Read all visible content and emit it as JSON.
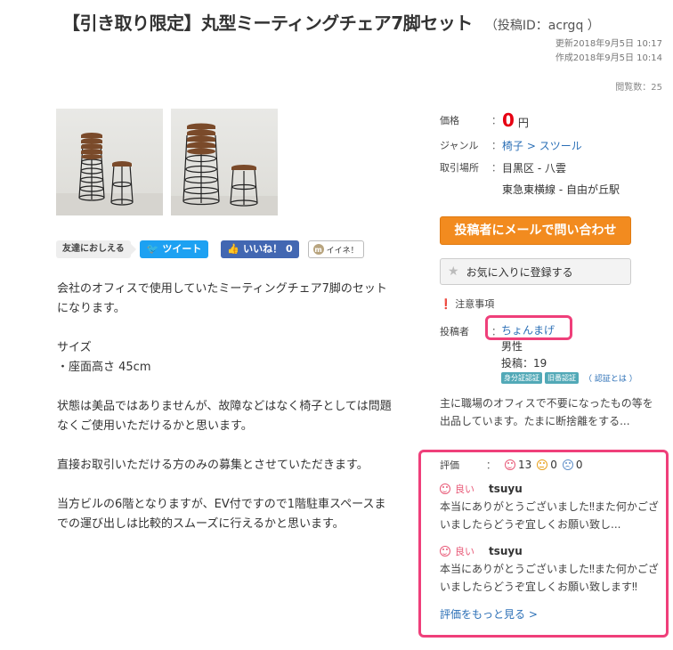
{
  "listing": {
    "title": "【引き取り限定】丸型ミーティングチェア7脚セット",
    "post_id": "（投稿ID：acrgq ）",
    "updated": "更新2018年9月5日 10:17",
    "created": "作成2018年9月5日 10:14",
    "views": "閲覧数：25"
  },
  "share": {
    "label": "友達におしえる",
    "tweet": "ツイート",
    "like": "いいね！ 0",
    "iine": "イイネ！"
  },
  "description": [
    "会社のオフィスで使用していたミーティングチェア7脚のセットになります。",
    "サイズ\n・座面高さ 45cm",
    "状態は美品ではありませんが、故障などはなく椅子としては問題なくご使用いただけるかと思います。",
    "直接お取引いただける方のみの募集とさせていただきます。",
    "当方ビルの6階となりますが、EV付ですので1階駐車スペースまでの運び出しは比較的スムーズに行えるかと思います。"
  ],
  "info": {
    "price_label": "価格",
    "price_value": "0",
    "price_unit": "円",
    "genre_label": "ジャンル",
    "genre_1": "椅子",
    "genre_sep": " > ",
    "genre_2": "スツール",
    "area_label": "取引場所",
    "area_1": "目黒区 - 八雲",
    "area_2": "東急東横線 - 自由が丘駅",
    "colon": "："
  },
  "buttons": {
    "mail": "投稿者にメールで問い合わせ",
    "favorite": "お気に入りに登録する"
  },
  "notice": "注意事項",
  "poster": {
    "label": "投稿者",
    "name": "ちょんまげ",
    "gender": "男性",
    "posts": "投稿：19",
    "badge_1": "身分証認証",
    "badge_2": "旧番認証",
    "badge_link": "（ 認証とは ）",
    "bio": "主に職場のオフィスで不要になったもの等を出品しています。たまに断捨離をする..."
  },
  "reviews": {
    "label": "評価",
    "good_count": "13",
    "neutral_count": "0",
    "bad_count": "0",
    "good_label": "良い",
    "items": [
      {
        "user": "tsuyu",
        "text": "本当にありがとうございました‼︎また何かございましたらどうぞ宜しくお願い致し..."
      },
      {
        "user": "tsuyu",
        "text": "本当にありがとうございました‼︎また何かございましたらどうぞ宜しくお願い致します‼︎"
      }
    ],
    "more": "評価をもっと見る >"
  },
  "colors": {
    "accent_orange": "#f28b1f",
    "price_red": "#e60012",
    "link_blue": "#2b6fb6",
    "highlight_pink": "#ef3f7a",
    "twitter": "#1da1f2",
    "facebook": "#4267b2"
  }
}
